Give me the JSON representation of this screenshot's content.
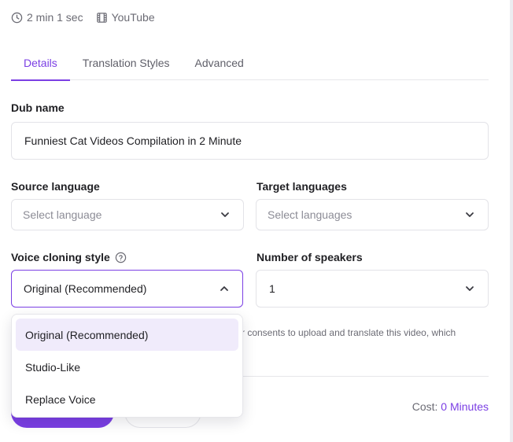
{
  "meta": {
    "duration": "2 min 1 sec",
    "source": "YouTube",
    "duration_icon": "clock-icon",
    "source_icon": "film-icon"
  },
  "tabs": [
    {
      "label": "Details",
      "active": true
    },
    {
      "label": "Translation Styles",
      "active": false
    },
    {
      "label": "Advanced",
      "active": false
    }
  ],
  "dub_name": {
    "label": "Dub name",
    "value": "Funniest Cat Videos Compilation in 2 Minute"
  },
  "source_language": {
    "label": "Source language",
    "placeholder": "Select language"
  },
  "target_languages": {
    "label": "Target languages",
    "placeholder": "Select languages"
  },
  "voice_cloning": {
    "label": "Voice cloning style",
    "value": "Original (Recommended)",
    "options": [
      "Original (Recommended)",
      "Studio-Like",
      "Replace Voice"
    ],
    "selected_index": 0
  },
  "speakers": {
    "label": "Number of speakers",
    "value": "1"
  },
  "consent_text": "r consents to upload and translate this video, which",
  "cost": {
    "label": "Cost:",
    "amount": "0 Minutes"
  },
  "colors": {
    "accent": "#7b3fe4",
    "selected_bg": "#f0ebfb",
    "muted_text": "#6b6b74"
  }
}
